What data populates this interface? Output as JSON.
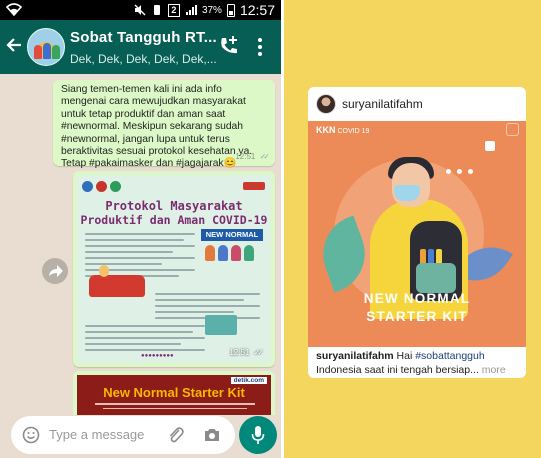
{
  "status_bar": {
    "battery": "37%",
    "time": "12:57",
    "signal_badge": "2"
  },
  "chat": {
    "title": "Sobat Tangguh RT...",
    "subtitle": "Dek, Dek, Dek, Dek, Dek,..."
  },
  "messages": {
    "text": {
      "body": "Siang temen-temen kali ini ada info mengenai cara mewujudkan masyarakat untuk tetap produktif dan aman saat #newnormal. Meskipun sekarang sudah #newnormal, jangan lupa untuk terus beraktivitas sesuai protokol kesehatan ya. Tetap #pakaimasker dan #jagajarak😊",
      "time": "12:51"
    },
    "image": {
      "poster_title_line1": "Protokol Masyarakat",
      "poster_title_line2": "Produktif dan Aman COVID-19",
      "poster_badge": "NEW NORMAL",
      "time": "12:51"
    },
    "link_preview": {
      "title": "New Normal Starter Kit",
      "brand": "detik.com"
    }
  },
  "input": {
    "placeholder": "Type a message"
  },
  "instagram": {
    "username": "suryanilatifahm",
    "post_logo": "KKN",
    "post_logo_suffix": "COVID 19",
    "post_line1": "NEW NORMAL",
    "post_line2": "STARTER KIT",
    "caption_user": "suryanilatifahm",
    "caption_word": "Hai",
    "caption_tag": "#sobattangguh",
    "caption_rest": "Indonesia saat ini tengah bersiap...",
    "caption_more": "more"
  },
  "colors": {
    "whatsapp_header": "#075e54",
    "bubble_outgoing": "#dcf8c6",
    "chat_background": "#e8ddd0",
    "mic_button": "#00897b",
    "story_background": "#f4d55d",
    "post_background": "#ec8b58"
  }
}
